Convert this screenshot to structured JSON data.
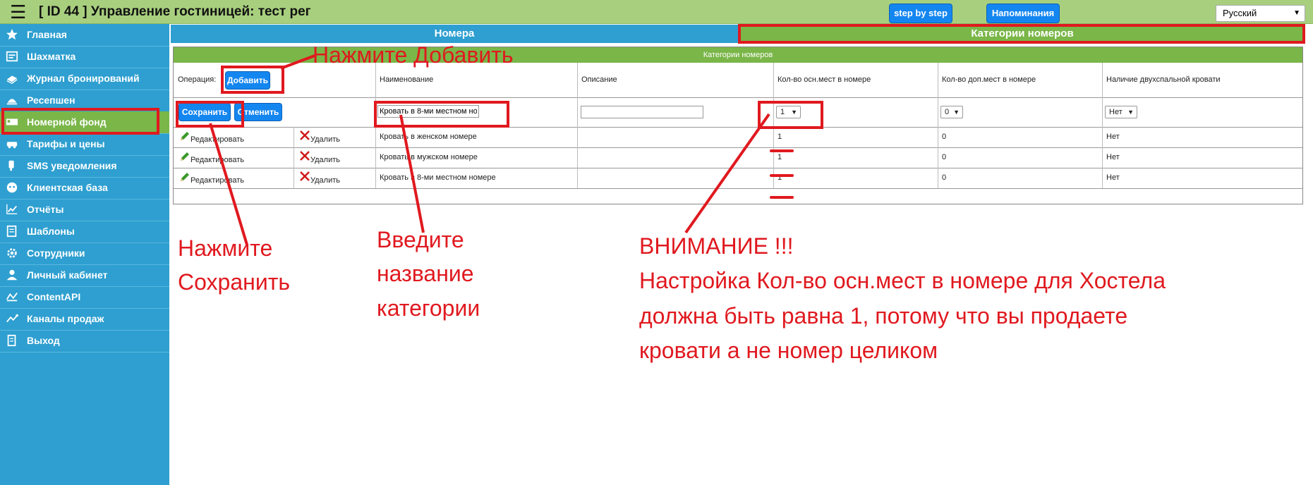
{
  "header": {
    "title": "[ ID 44 ] Управление гостиницей: тест рег",
    "step_by_step": "step by step",
    "reminders": "Напоминания",
    "language": "Русский"
  },
  "sidebar": {
    "items": [
      {
        "label": "Главная",
        "icon": "star-icon"
      },
      {
        "label": "Шахматка",
        "icon": "grid-icon"
      },
      {
        "label": "Журнал бронирований",
        "icon": "book-icon"
      },
      {
        "label": "Ресепшен",
        "icon": "bell-icon"
      },
      {
        "label": "Номерной фонд",
        "icon": "bed-icon"
      },
      {
        "label": "Тарифы и цены",
        "icon": "car-icon"
      },
      {
        "label": "SMS уведомления",
        "icon": "phone-icon"
      },
      {
        "label": "Клиентская база",
        "icon": "user-icon"
      },
      {
        "label": "Отчёты",
        "icon": "chart-icon"
      },
      {
        "label": "Шаблоны",
        "icon": "template-icon"
      },
      {
        "label": "Сотрудники",
        "icon": "gear-icon"
      },
      {
        "label": "Личный кабинет",
        "icon": "person-icon"
      },
      {
        "label": "ContentAPI",
        "icon": "api-icon"
      },
      {
        "label": "Каналы продаж",
        "icon": "channels-icon"
      },
      {
        "label": "Выход",
        "icon": "exit-icon"
      }
    ],
    "active_index": 4
  },
  "tabs": {
    "rooms": "Номера",
    "categories": "Категории номеров"
  },
  "table": {
    "caption": "Категории номеров",
    "operation_label": "Операция:",
    "add_button": "Добавить",
    "columns": [
      "Наименование",
      "Описание",
      "Кол-во осн.мест в номере",
      "Кол-во доп.мест в номере",
      "Наличие двухспальной кровати"
    ],
    "form": {
      "save_button": "Сохранить",
      "cancel_button": "Отменить",
      "name_value": "Кровать в 8-ми местном но",
      "description_value": "",
      "main_places": "1",
      "extra_places": "0",
      "double_bed": "Нет"
    },
    "edit_label": "Редактировать",
    "delete_label": "Удалить",
    "rows": [
      {
        "name": "Кровать в женском номере",
        "description": "",
        "main_places": "1",
        "extra_places": "0",
        "double_bed": "Нет"
      },
      {
        "name": "Кровать в мужском номере",
        "description": "",
        "main_places": "1",
        "extra_places": "0",
        "double_bed": "Нет"
      },
      {
        "name": "Кровать в 8-ми местном номере",
        "description": "",
        "main_places": "1",
        "extra_places": "0",
        "double_bed": "Нет"
      }
    ]
  },
  "annotations": {
    "press_add": "Нажмите Добавить",
    "press_save": [
      "Нажмите",
      "Сохранить"
    ],
    "enter_name": [
      "Введите",
      "название",
      "категории"
    ],
    "warning": [
      "ВНИМАНИЕ !!!",
      "Настройка Кол-во осн.мест в номере для Хостела",
      "должна быть равна 1, потому что вы продаете",
      "кровати а не номер целиком"
    ]
  },
  "colors": {
    "header_green": "#a8cf7e",
    "sidebar_blue": "#2e9fd0",
    "active_green": "#7ab648",
    "button_blue": "#1486f0",
    "annotation_red": "#e0191f"
  }
}
